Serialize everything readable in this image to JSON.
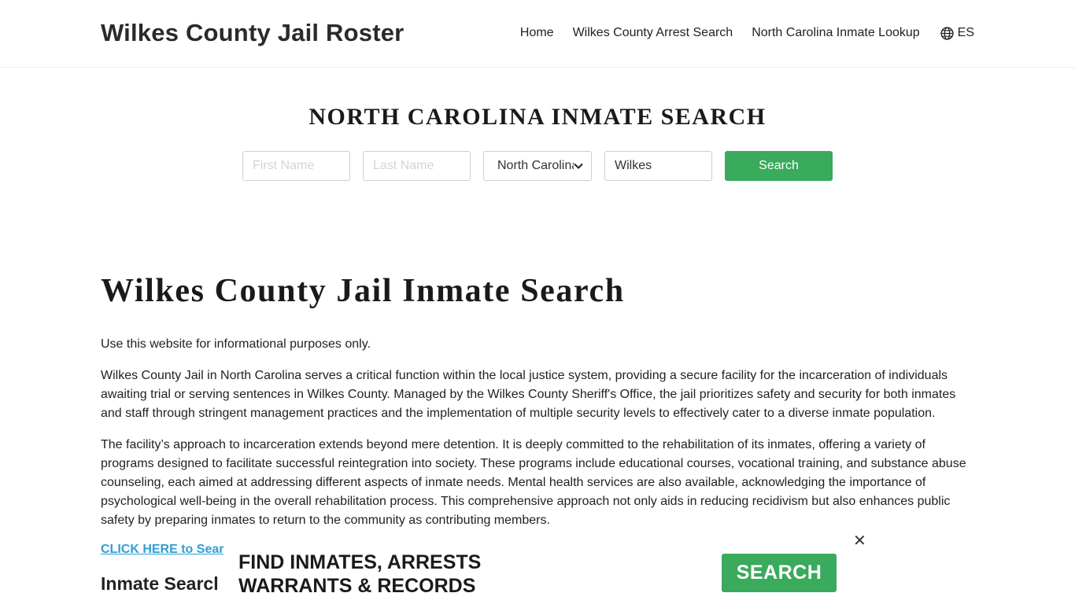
{
  "header": {
    "site_title": "Wilkes County Jail Roster",
    "nav": {
      "home": "Home",
      "arrest_search": "Wilkes County Arrest Search",
      "inmate_lookup": "North Carolina Inmate Lookup",
      "language": "ES",
      "language_icon": "globe-icon"
    }
  },
  "search": {
    "title": "NORTH CAROLINA INMATE SEARCH",
    "first_name_placeholder": "First Name",
    "last_name_placeholder": "Last Name",
    "state_selected": "North Carolina",
    "county_value": "Wilkes",
    "button_label": "Search"
  },
  "main": {
    "title": "Wilkes County Jail Inmate Search",
    "paragraphs": [
      "Use this website for informational purposes only.",
      "Wilkes County Jail in North Carolina serves a critical function within the local justice system, providing a secure facility for the incarceration of individuals awaiting trial or serving sentences in Wilkes County. Managed by the Wilkes County Sheriff's Office, the jail prioritizes safety and security for both inmates and staff through stringent management practices and the implementation of multiple security levels to effectively cater to a diverse inmate population.",
      "The facility’s approach to incarceration extends beyond mere detention. It is deeply committed to the rehabilitation of its inmates, offering a variety of programs designed to facilitate successful reintegration into society. These programs include educational courses, vocational training, and substance abuse counseling, each aimed at addressing different aspects of inmate needs. Mental health services are also available, acknowledging the importance of psychological well-being in the overall rehabilitation process. This comprehensive approach not only aids in reducing recidivism but also enhances public safety by preparing inmates to return to the community as contributing members."
    ],
    "cta_link": "CLICK HERE to Sear",
    "sub_heading": "Inmate Searcl"
  },
  "ad": {
    "line1": "FIND INMATES, ARRESTS",
    "line2": "WARRANTS & RECORDS",
    "button_label": "SEARCH",
    "close_label": "✕"
  },
  "colors": {
    "accent_green": "#3aaa5c",
    "link_blue": "#2e9fd4"
  }
}
